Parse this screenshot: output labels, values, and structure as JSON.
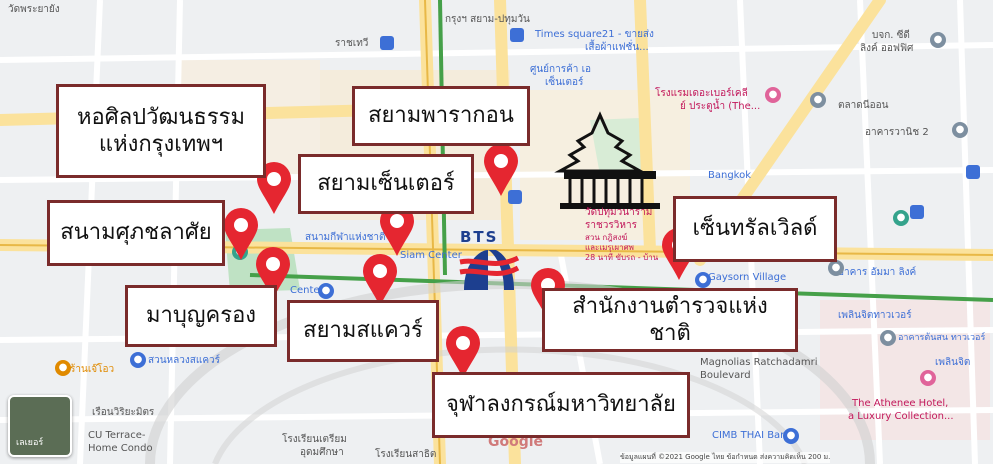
{
  "labels": {
    "hosilp": "หอศิลปวัฒนธรรม\nแห่งกรุงเทพฯ",
    "siam_paragon": "สยามพารากอน",
    "siam_center": "สยามเซ็นเตอร์",
    "supachalasai": "สนามศุภชลาศัย",
    "central_world": "เซ็นทรัลเวิลด์",
    "mbk": "มาบุญครอง",
    "siam_square": "สยามสแควร์",
    "police": "สำนักงานตำรวจแห่งชาติ",
    "chula": "จุฬาลงกรณ์มหาวิทยาลัย"
  },
  "bts_logo_text": "BTS",
  "basemap": {
    "wat_top_left": "วัดพระยายัง",
    "pathumwan_road": "กรุงฯ สยาม-ปทุมวัน",
    "ratchathewi": "ราชเทวี",
    "times_square": "Times square21 - ขายส่ง",
    "times_square_2": "เสื้อผ้าแฟชั่น...",
    "shopping_center": "ศูนย์การค้า เอ",
    "shopping_center_2": "เซ็นเตอร์",
    "hotel": "โรงแรมเดอะเบอร์เคลี",
    "hotel_2": "ย์ ประตูน้ำ (The...",
    "market": "ตลาดนีออน",
    "building": "อาคารวานิช 2",
    "company": "บจก. ซีดี",
    "company_2": "ลิงค์ ออฟฟิศ",
    "bangkok": "Bangkok",
    "wat_pathum": "วัดปทุมวนาราม",
    "wat_pathum_2": "ราชวรวิหาร",
    "wat_pathum_3": "สวน กฎิสงฆ์",
    "wat_pathum_4": "และเมรุเผาศพ",
    "wat_pathum_5": "28 นาที ขับรถ - บ้าน",
    "stadium": "สนามกีฬาแห่งชาติ",
    "siam_center_map": "Siam Center",
    "center_map": "Center",
    "gaysorn": "Gaysorn Village",
    "amarin": "อาคาร อัมมา ลิงค์",
    "ploenchit_tower": "เพลินจิตทาวเวอร์",
    "ton_son": "อาคารต้นสน ทาวเวอร์",
    "ploenchit": "เพลินจิต",
    "ratchadamri": "Magnolias Ratchadamri",
    "boulevard": "Boulevard",
    "athenee": "The Athenee Hotel,",
    "athenee_2": "a Luxury Collection...",
    "cimb": "CIMB THAI Bank",
    "cu_terrace": "CU Terrace-",
    "cu_terrace_2": "Home Condo",
    "school": "เรือนวิริยะมิตร",
    "school_2": "โรงเรียนเตรียม",
    "school_3": "อุดมศึกษา",
    "school_4": "โรงเรียนสาธิต",
    "lido": "สวนหลวงสแควร์",
    "restaurant": "ร้านเจ๊โอว",
    "google": "Google",
    "layers": "เลเยอร์",
    "attribution": "ข้อมูลแผนที่ ©2021 Google   ไทย   ข้อกำหนด   ส่งความคิดเห็น   200 ม."
  },
  "colors": {
    "pin": "#e52630",
    "frame": "#7a2b2b",
    "road": "#ffffff",
    "major_road": "#fbe29c",
    "park": "#bfe2c4"
  }
}
